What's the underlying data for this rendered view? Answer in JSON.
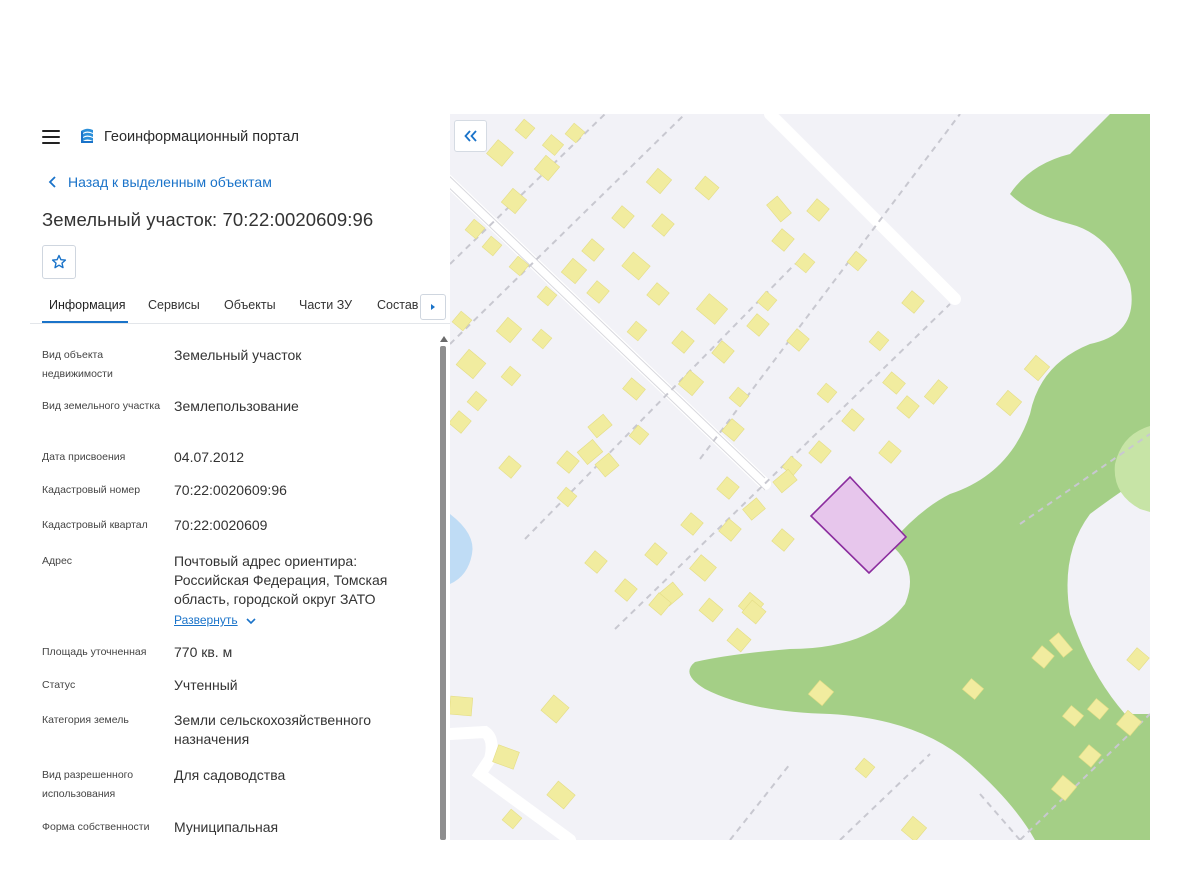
{
  "app": {
    "title": "Геоинформационный портал"
  },
  "nav": {
    "back_label": "Назад к выделенным объектам"
  },
  "object": {
    "title": "Земельный участок: 70:22:0020609:96"
  },
  "tabs": [
    {
      "label": "Информация",
      "active": true
    },
    {
      "label": "Сервисы",
      "active": false
    },
    {
      "label": "Объекты",
      "active": false
    },
    {
      "label": "Части ЗУ",
      "active": false
    },
    {
      "label": "Состав",
      "active": false
    }
  ],
  "properties": [
    {
      "key": "Вид объекта недвижимости",
      "value": "Земельный участок"
    },
    {
      "key": "Вид земельного участка",
      "value": "Землепользование"
    },
    {
      "key": "Дата присвоения",
      "value": "04.07.2012"
    },
    {
      "key": "Кадастровый номер",
      "value": "70:22:0020609:96"
    },
    {
      "key": "Кадастровый квартал",
      "value": "70:22:0020609"
    },
    {
      "key": "Адрес",
      "value": "Почтовый адрес ориентира: Российская Федерация, Томская область, городской округ ЗАТО"
    },
    {
      "key": "Площадь уточненная",
      "value": "770 кв. м"
    },
    {
      "key": "Статус",
      "value": "Учтенный"
    },
    {
      "key": "Категория земель",
      "value": "Земли сельскохозяйственного назначения"
    },
    {
      "key": "Вид разрешенного использования",
      "value": "Для садоводства"
    },
    {
      "key": "Форма собственности",
      "value": "Муниципальная"
    }
  ],
  "address_expand_label": "Развернуть",
  "colors": {
    "accent": "#1a73c9",
    "map_background": "#f2f2f7",
    "building": "#f1ec9f",
    "vegetation": "#a4cf86",
    "water": "#bfdcf5",
    "selected_parcel_fill": "#e7c6ec",
    "selected_parcel_stroke": "#8b2c9e"
  },
  "icons": {
    "menu": "hamburger-icon",
    "logo": "portal-logo-icon",
    "back": "chevron-left-icon",
    "favorite": "star-icon",
    "tabs_next": "triangle-right-icon",
    "expand": "chevron-down-icon",
    "collapse_panel": "double-chevron-left-icon"
  }
}
